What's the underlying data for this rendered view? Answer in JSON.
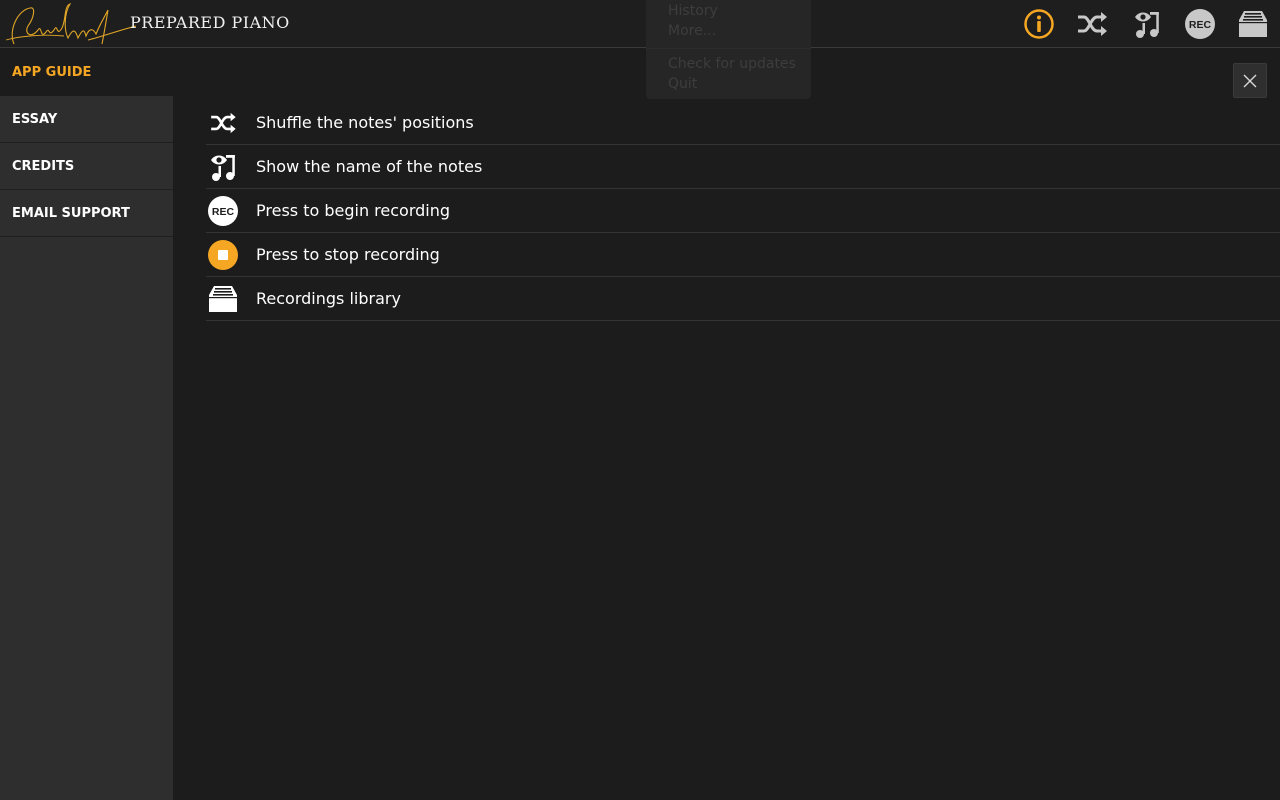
{
  "header": {
    "signature": "John Cage",
    "app_title": "PREPARED PIANO",
    "icons": [
      "info-icon",
      "shuffle-icon",
      "show-notes-icon",
      "record-icon",
      "library-icon"
    ],
    "rec_label": "REC"
  },
  "menu": {
    "items": [
      "History",
      "More...",
      "Check for updates",
      "Quit"
    ]
  },
  "sidebar": {
    "items": [
      {
        "label": "APP GUIDE",
        "active": true
      },
      {
        "label": "ESSAY",
        "active": false
      },
      {
        "label": "CREDITS",
        "active": false
      },
      {
        "label": "EMAIL SUPPORT",
        "active": false
      }
    ]
  },
  "guide": {
    "rows": [
      {
        "icon": "shuffle-icon",
        "text": "Shuffle the notes' positions"
      },
      {
        "icon": "show-notes-icon",
        "text": "Show the name of the notes"
      },
      {
        "icon": "record-icon",
        "text": "Press to begin recording",
        "icon_label": "REC"
      },
      {
        "icon": "stop-record-icon",
        "text": "Press to stop recording"
      },
      {
        "icon": "library-icon",
        "text": "Recordings library"
      }
    ]
  },
  "colors": {
    "accent": "#f5a623",
    "background": "#1c1c1c",
    "sidebar": "#2e2e2e"
  }
}
